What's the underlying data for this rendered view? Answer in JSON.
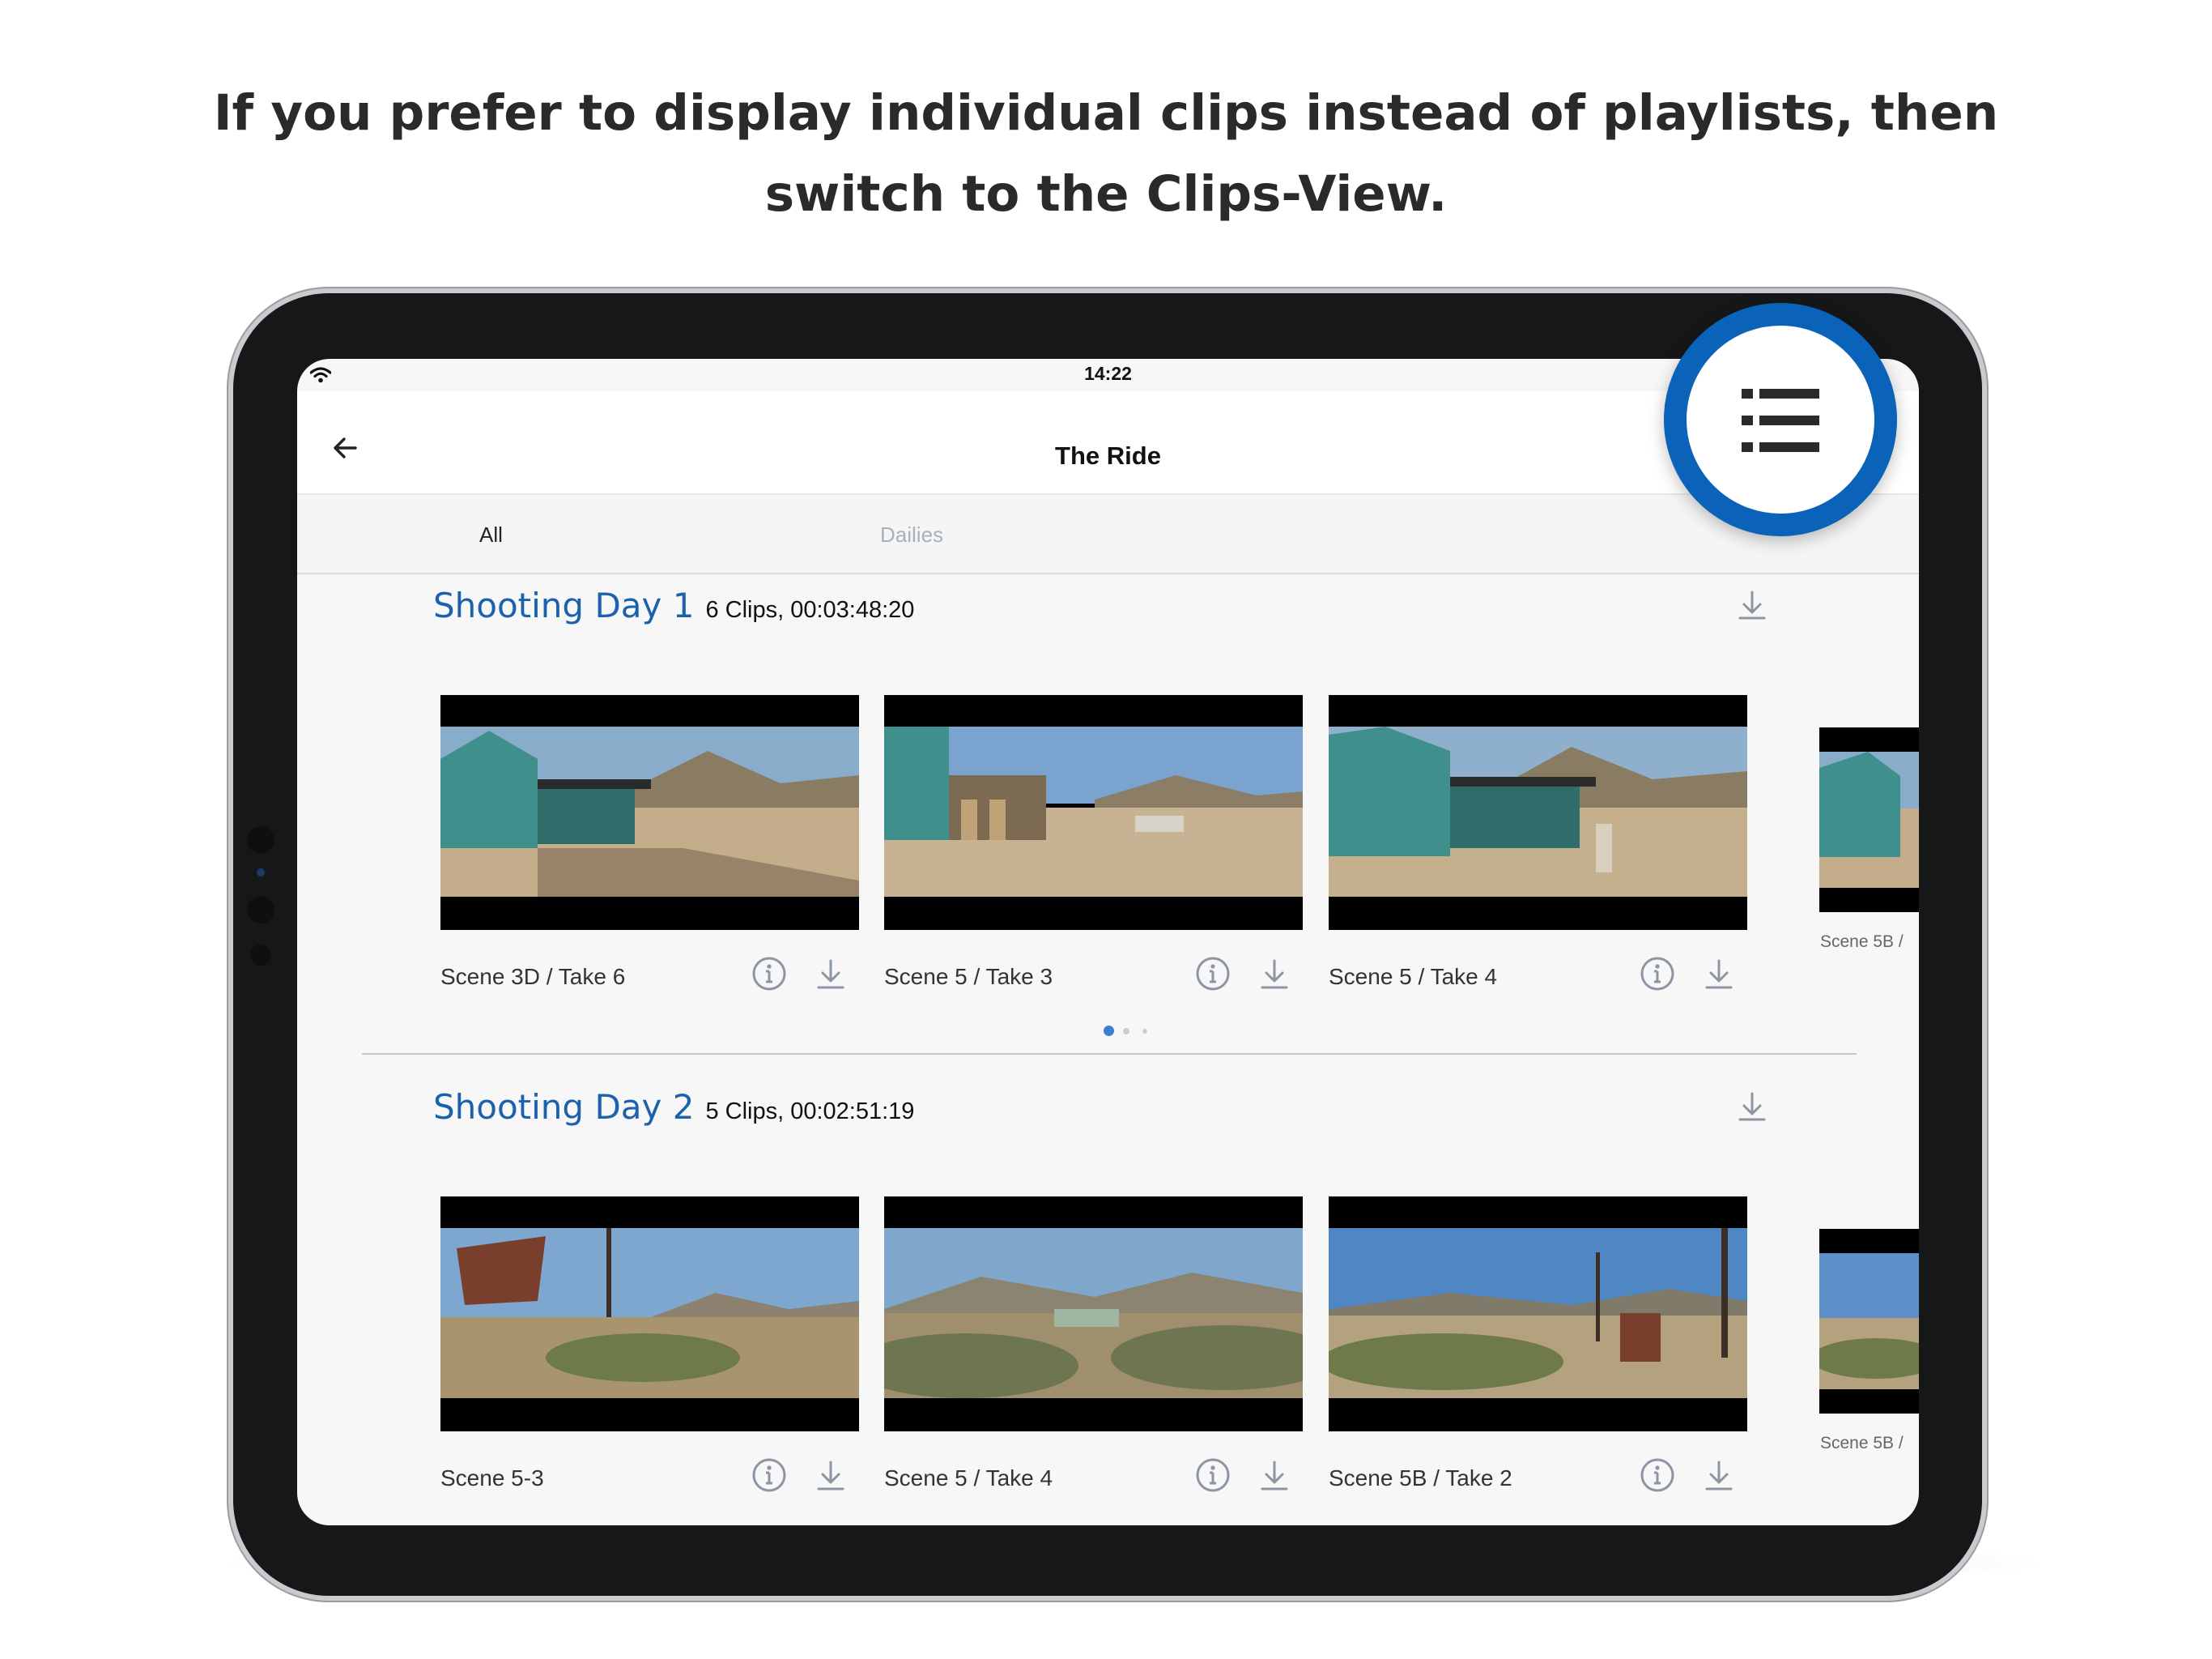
{
  "caption": {
    "line1": "If you prefer to display individual clips instead of playlists, then",
    "line2": "switch to the Clips-View."
  },
  "status_bar": {
    "time": "14:22",
    "wifi_icon": "wifi-icon"
  },
  "navbar": {
    "title": "The Ride",
    "back_icon": "arrow-left-icon"
  },
  "tabs": [
    {
      "label": "All",
      "selected": true
    },
    {
      "label": "Dailies",
      "selected": false
    }
  ],
  "sections": [
    {
      "title": "Shooting Day 1",
      "meta": "6 Clips, 00:03:48:20",
      "clips": [
        {
          "label": "Scene 3D  / Take 6"
        },
        {
          "label": "Scene 5  / Take 3"
        },
        {
          "label": "Scene 5  / Take 4"
        }
      ],
      "peek_label": "Scene 5B  /"
    },
    {
      "title": "Shooting Day 2",
      "meta": "5 Clips, 00:02:51:19",
      "clips": [
        {
          "label": "Scene 5-3"
        },
        {
          "label": "Scene 5  / Take 4"
        },
        {
          "label": "Scene 5B  / Take 2"
        }
      ],
      "peek_label": "Scene 5B  /"
    }
  ],
  "page_indicator": {
    "count": 3,
    "active": 0
  },
  "highlight": {
    "icon": "list-view-icon"
  },
  "colors": {
    "accent": "#1b62ad",
    "highlight_ring": "#0a63b9",
    "inactive_tab": "#a9b1bb"
  }
}
